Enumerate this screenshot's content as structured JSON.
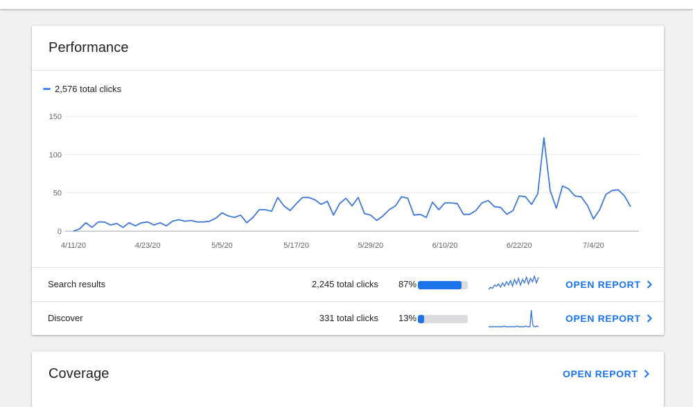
{
  "performance": {
    "title": "Performance",
    "legend_label": "2,576 total clicks",
    "chart_data": {
      "type": "line",
      "series": [
        {
          "name": "2,576 total clicks",
          "color": "#3c78d8",
          "values": [
            0,
            3,
            11,
            5,
            12,
            12,
            8,
            10,
            5,
            11,
            7,
            11,
            12,
            8,
            11,
            7,
            13,
            15,
            13,
            14,
            12,
            12,
            13,
            17,
            24,
            20,
            18,
            21,
            11,
            18,
            28,
            28,
            26,
            44,
            33,
            27,
            36,
            44,
            44,
            41,
            35,
            39,
            21,
            36,
            43,
            33,
            44,
            23,
            21,
            14,
            20,
            28,
            33,
            45,
            43,
            21,
            22,
            18,
            38,
            28,
            37,
            37,
            36,
            22,
            22,
            27,
            37,
            40,
            32,
            31,
            22,
            27,
            46,
            45,
            35,
            49,
            122,
            53,
            30,
            59,
            55,
            46,
            45,
            34,
            16,
            28,
            48,
            53,
            54,
            46,
            32
          ]
        }
      ],
      "x_tick_labels": [
        "4/11/20",
        "4/23/20",
        "5/5/20",
        "5/17/20",
        "5/29/20",
        "6/10/20",
        "6/22/20",
        "7/4/20"
      ],
      "y_tick_labels": [
        "0",
        "50",
        "100",
        "150"
      ],
      "ylim": [
        0,
        150
      ],
      "grid": true
    },
    "rows": [
      {
        "label": "Search results",
        "clicks": "2,245 total clicks",
        "pct": "87%",
        "pct_value": 87,
        "open_label": "OPEN REPORT",
        "spark": [
          3,
          5,
          4,
          7,
          6,
          8,
          5,
          9,
          6,
          10,
          7,
          11,
          6,
          12,
          8,
          13,
          7,
          12,
          9,
          14,
          8,
          13,
          10,
          15,
          9,
          14
        ]
      },
      {
        "label": "Discover",
        "clicks": "331 total clicks",
        "pct": "13%",
        "pct_value": 13,
        "open_label": "OPEN REPORT",
        "spark": [
          0,
          0,
          0,
          0,
          0,
          0,
          0,
          0,
          0,
          0,
          0,
          1,
          0,
          0,
          0,
          0,
          0,
          0,
          0,
          0,
          1,
          0,
          0,
          0,
          0,
          0,
          1,
          0,
          0,
          0,
          22,
          2,
          0,
          0,
          1,
          0
        ]
      }
    ]
  },
  "coverage": {
    "title": "Coverage",
    "open_label": "OPEN REPORT"
  },
  "icons": {
    "chevron": "chevron-right-icon"
  }
}
